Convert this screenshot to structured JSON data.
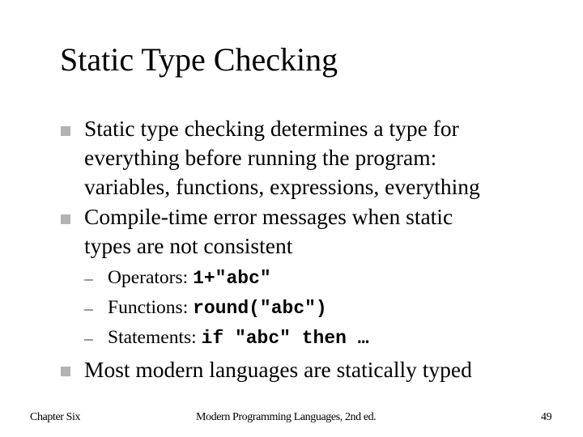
{
  "slide": {
    "title": "Static Type Checking",
    "bullets": [
      {
        "lines": [
          "Static type checking determines a type for",
          "everything before running the program:",
          "variables, functions, expressions, everything"
        ]
      },
      {
        "lines": [
          "Compile-time error messages when static",
          "types are not consistent"
        ],
        "subbullets": [
          {
            "label": "Operators: ",
            "code": "1+\"abc\""
          },
          {
            "label": "Functions: ",
            "code": "round(\"abc\")"
          },
          {
            "label": "Statements: ",
            "code": "if \"abc\" then …"
          }
        ]
      },
      {
        "lines": [
          "Most modern languages are statically typed"
        ]
      }
    ],
    "footer": {
      "left": "Chapter Six",
      "center": "Modern Programming Languages, 2nd ed.",
      "page_number": "49"
    }
  }
}
